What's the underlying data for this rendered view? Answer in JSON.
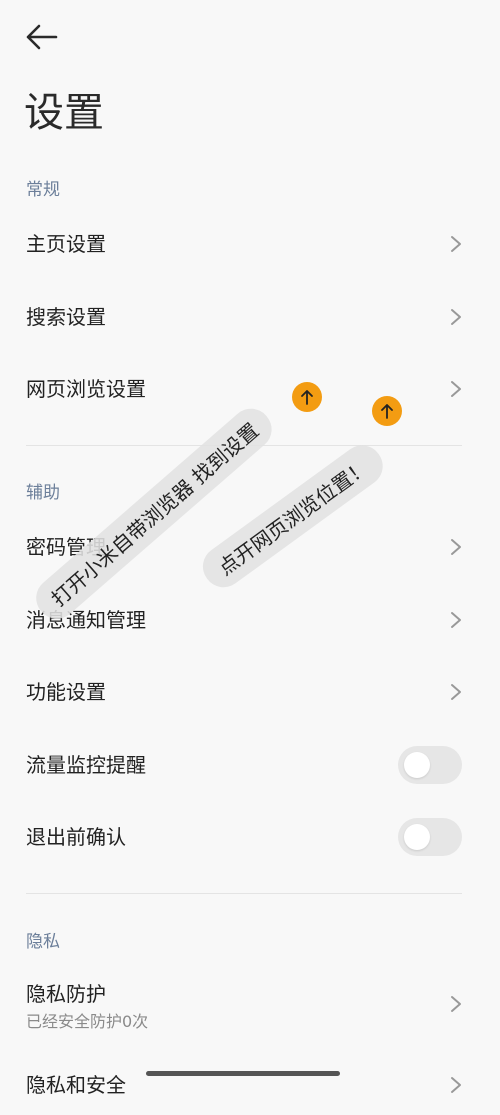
{
  "header": {
    "title": "设置"
  },
  "sections": {
    "general": {
      "title": "常规",
      "items": [
        {
          "label": "主页设置"
        },
        {
          "label": "搜索设置"
        },
        {
          "label": "网页浏览设置"
        }
      ]
    },
    "assist": {
      "title": "辅助",
      "items": [
        {
          "label": "密码管理"
        },
        {
          "label": "消息通知管理"
        },
        {
          "label": "功能设置"
        },
        {
          "label": "流量监控提醒",
          "toggle": false
        },
        {
          "label": "退出前确认",
          "toggle": false
        }
      ]
    },
    "privacy": {
      "title": "隐私",
      "items": [
        {
          "label": "隐私防护",
          "sub": "已经安全防护0次"
        },
        {
          "label": "隐私和安全"
        }
      ]
    }
  },
  "annotations": {
    "note1": "打开小米自带浏览器 找到设置",
    "note2": "点开网页浏览位置！"
  },
  "colors": {
    "accent_badge": "#f39c12",
    "section_header": "#6c7f9a"
  },
  "icons": [
    "back-arrow-icon",
    "chevron-right-icon",
    "up-arrow-icon"
  ]
}
